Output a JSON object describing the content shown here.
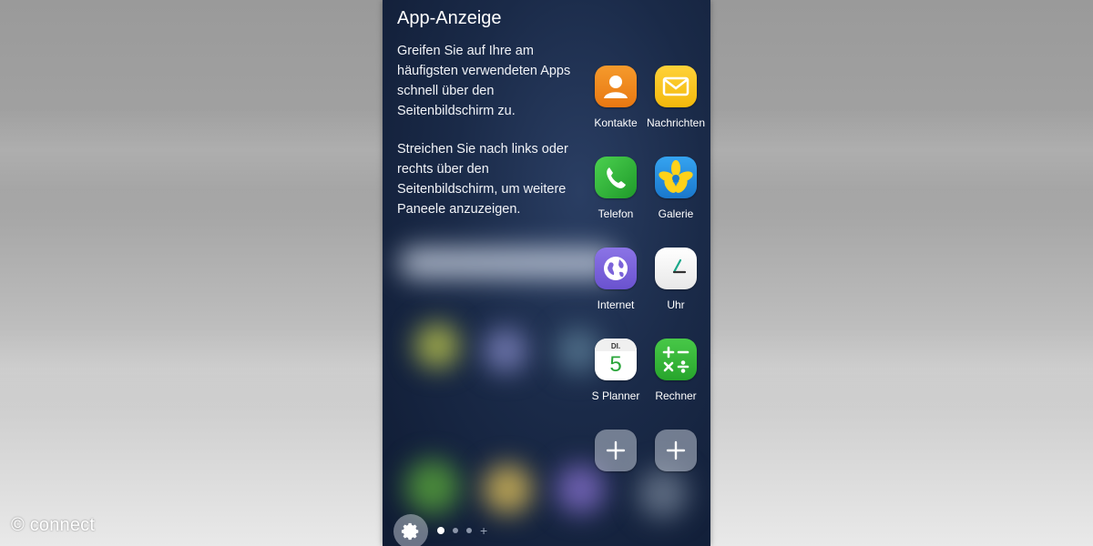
{
  "screen": {
    "title": "App-Anzeige",
    "description_1": "Greifen Sie auf Ihre am häufigsten verwendeten Apps schnell über den Seitenbildschirm zu.",
    "description_2": "Streichen Sie nach links oder rechts über den Seitenbildschirm, um weitere Paneele anzuzeigen."
  },
  "apps": [
    {
      "label": "Kontakte",
      "icon": "contacts-icon",
      "color": "#f08a1c"
    },
    {
      "label": "Nachrichten",
      "icon": "messages-icon",
      "color": "#f7c318"
    },
    {
      "label": "Telefon",
      "icon": "phone-icon",
      "color": "#35b83a"
    },
    {
      "label": "Galerie",
      "icon": "gallery-icon",
      "color": "#2a8fe0"
    },
    {
      "label": "Internet",
      "icon": "internet-icon",
      "color": "#7b63d9"
    },
    {
      "label": "Uhr",
      "icon": "clock-icon",
      "color": "#f5f5f5"
    },
    {
      "label": "S Planner",
      "icon": "calendar-icon",
      "color": "#ffffff",
      "badge_day": "DI.",
      "badge_date": "5"
    },
    {
      "label": "Rechner",
      "icon": "calculator-icon",
      "color": "#3cb83c",
      "symbols": "+ − × ÷"
    }
  ],
  "add_slots": [
    {
      "icon": "plus-icon"
    },
    {
      "icon": "plus-icon"
    }
  ],
  "footer": {
    "settings_icon": "gear-icon",
    "page_count": 3,
    "active_page": 1,
    "add_page_symbol": "+"
  },
  "watermark": "© connect"
}
